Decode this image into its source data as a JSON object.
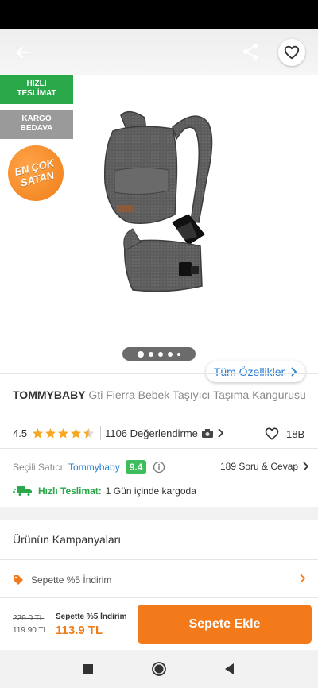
{
  "badges": {
    "fast_delivery_line1": "HIZLI",
    "fast_delivery_line2": "TESLİMAT",
    "free_shipping_line1": "KARGO",
    "free_shipping_line2": "BEDAVA",
    "best_seller_line1": "EN ÇOK",
    "best_seller_line2": "SATAN"
  },
  "gallery": {
    "dots_count": 5,
    "active_index": 0,
    "all_features_label": "Tüm Özellikler"
  },
  "product": {
    "brand": "TOMMYBABY",
    "name": "Gti Fierra Bebek Taşıyıcı Taşıma Kangurusu"
  },
  "rating": {
    "score": "4.5",
    "stars_value": 4.5,
    "review_count_text": "1106 Değerlendirme",
    "likes": "18B"
  },
  "seller": {
    "label": "Seçili Satıcı:",
    "name": "Tommybaby",
    "score": "9.4",
    "qa_label": "189 Soru & Cevap"
  },
  "delivery": {
    "label": "Hızlı Teslimat:",
    "text": "1 Gün içinde kargoda"
  },
  "campaigns": {
    "title": "Ürünün Kampanyaları",
    "items": [
      {
        "label": "Sepette %5 İndirim"
      }
    ]
  },
  "pricing": {
    "old_price": "229.0 TL",
    "discounted_price": "119.90 TL",
    "cart_discount_label": "Sepette %5 İndirim",
    "final_price": "113.9 TL",
    "add_to_cart_label": "Sepete Ekle"
  },
  "colors": {
    "accent_orange": "#f27a1a",
    "green": "#2aa84a",
    "link_blue": "#2a7fd4",
    "star": "#f7a823"
  }
}
